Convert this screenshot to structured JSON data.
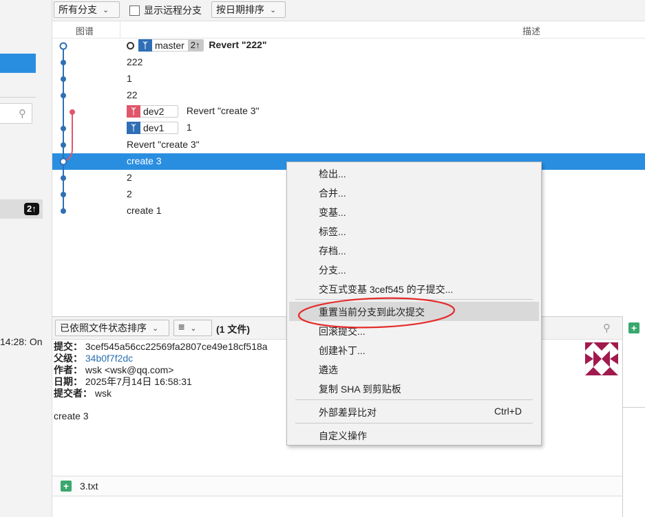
{
  "toolbar": {
    "branch_filter": "所有分支",
    "show_remote_label": "显示远程分支",
    "sort_label": "按日期排序"
  },
  "graph_header": {
    "graph_col": "图谱",
    "desc_col": "描述"
  },
  "commits": [
    {
      "message": "Revert \"222\"",
      "branch": "master",
      "ahead": "2↑"
    },
    {
      "message": "222"
    },
    {
      "message": "1"
    },
    {
      "message": "22"
    },
    {
      "message": "Revert \"create 3\"",
      "branch": "dev2"
    },
    {
      "message": "1",
      "branch": "dev1"
    },
    {
      "message": "Revert \"create 3\""
    },
    {
      "message": "create 3",
      "selected": true
    },
    {
      "message": "2"
    },
    {
      "message": "2"
    },
    {
      "message": "create 1"
    }
  ],
  "left_panel": {
    "badge": "2↑",
    "time_fragment": "14:28: On"
  },
  "context_menu": {
    "items": [
      "检出...",
      "合并...",
      "变基...",
      "标签...",
      "存档...",
      "分支...",
      "交互式变基 3cef545 的子提交..."
    ],
    "group2": [
      "重置当前分支到此次提交",
      "回滚提交...",
      "创建补丁...",
      "遴选",
      "复制 SHA 到剪贴板"
    ],
    "external_diff": "外部差异比对",
    "external_diff_shortcut": "Ctrl+D",
    "custom_action": "自定义操作"
  },
  "lower_toolbar": {
    "status_sort": "已依照文件状态排序",
    "list_icon": "≡",
    "file_count": "(1 文件)"
  },
  "details": {
    "commit_label": "提交：",
    "commit_value": "3cef545a56cc22569fa2807ce49e18cf518a",
    "parent_label": "父级：",
    "parent_value": "34b0f7f2dc",
    "author_label": "作者：",
    "author_value": "wsk <wsk@qq.com>",
    "date_label": "日期：",
    "date_value": "2025年7月14日 16:58:31",
    "committer_label": "提交者：",
    "committer_value": "wsk",
    "message": "create 3"
  },
  "files": [
    {
      "name": "3.txt",
      "status": "added"
    }
  ],
  "colors": {
    "selection": "#2a8ee0",
    "main_lane": "#2f6fb5",
    "dev2_lane": "#e0566b",
    "added": "#3aa76d",
    "annotation": "#e52b2b"
  }
}
